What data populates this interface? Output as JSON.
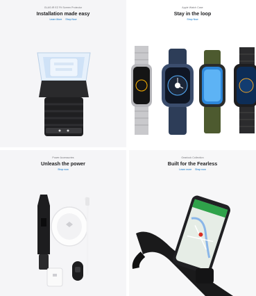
{
  "tiles": [
    {
      "eyebrow": "GLAS.tR EZ Fit Screen Protector",
      "title": "Installation made easy",
      "links": [
        "Learn More",
        "Shop Now"
      ]
    },
    {
      "eyebrow": "Apple Watch Case",
      "title": "Stay in the loop",
      "links": [
        "Shop Now"
      ]
    },
    {
      "eyebrow": "Power Accessories",
      "title": "Unleash the power",
      "links": [
        "Shop now"
      ]
    },
    {
      "eyebrow": "Gearlock Collection",
      "title": "Built for the Fearless",
      "links": [
        "Learn more",
        "Shop now"
      ]
    }
  ],
  "colors": {
    "link": "#0070c9",
    "tile_bg": "#f5f5f7"
  }
}
